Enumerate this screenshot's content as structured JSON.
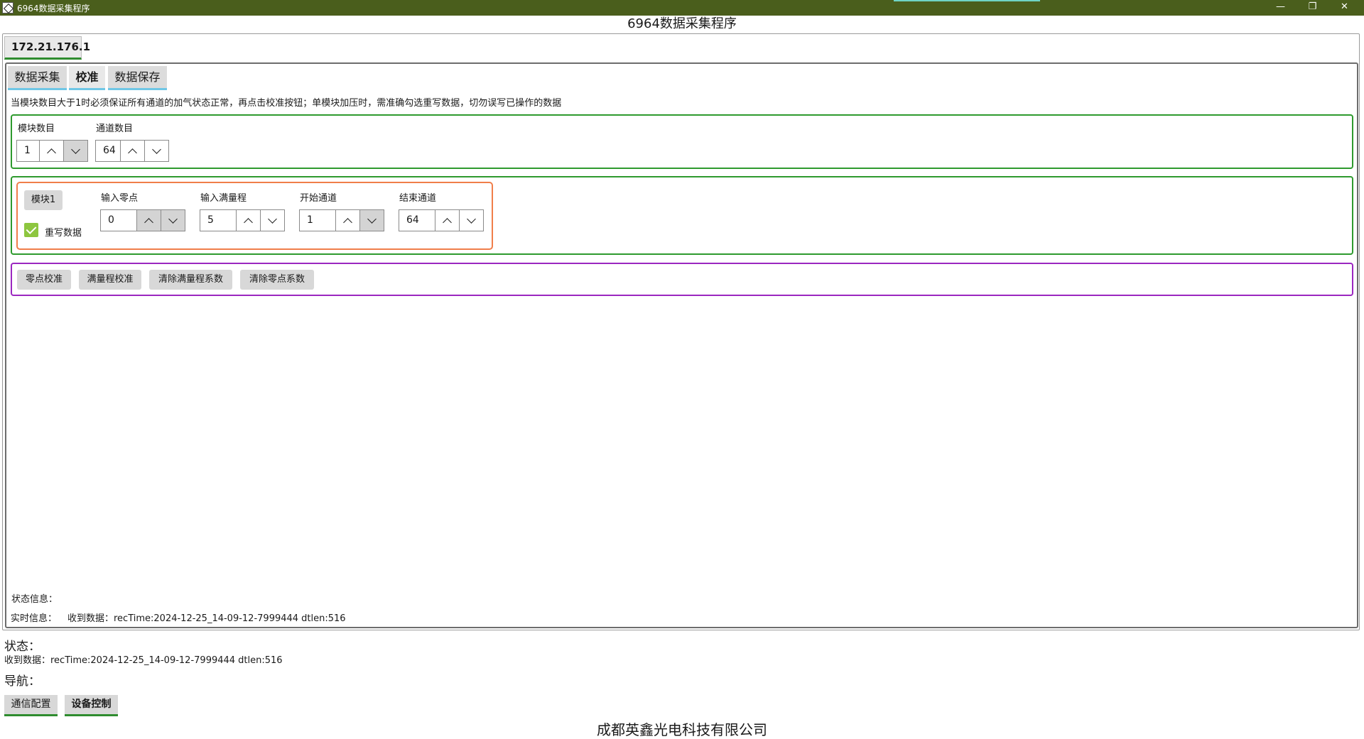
{
  "window": {
    "title": "6964数据采集程序",
    "minimize": "—",
    "restore": "❐",
    "close": "✕"
  },
  "header": {
    "title": "6964数据采集程序"
  },
  "device_tab": {
    "label": "172.21.176.1"
  },
  "tabs": [
    {
      "label": "数据采集"
    },
    {
      "label": "校准"
    },
    {
      "label": "数据保存"
    }
  ],
  "calibration": {
    "instruction": "当模块数目大于1时必须保证所有通道的加气状态正常，再点击校准按钮；单模块加压时，需准确勾选重写数据，切勿误写已操作的数据",
    "module_count": {
      "label": "模块数目",
      "value": "1"
    },
    "channel_count": {
      "label": "通道数目",
      "value": "64"
    },
    "module1": {
      "button": "模块1",
      "rewrite_label": "重写数据",
      "rewrite_checked": true,
      "zero_input": {
        "label": "输入零点",
        "value": "0"
      },
      "full_scale": {
        "label": "输入满量程",
        "value": "5"
      },
      "start_channel": {
        "label": "开始通道",
        "value": "1"
      },
      "end_channel": {
        "label": "结束通道",
        "value": "64"
      }
    },
    "actions": {
      "zero_cal": "零点校准",
      "full_cal": "满量程校准",
      "clear_full": "清除满量程系数",
      "clear_zero": "清除零点系数"
    },
    "status_info_label": "状态信息：",
    "realtime_info_label": "实时信息：",
    "realtime_info_value": "收到数据：recTime:2024-12-25_14-09-12-7999444 dtlen:516"
  },
  "status": {
    "label": "状态：",
    "message": "收到数据：recTime:2024-12-25_14-09-12-7999444 dtlen:516"
  },
  "nav": {
    "label": "导航：",
    "comm_config": "通信配置",
    "device_control": "设备控制"
  },
  "footer": {
    "company": "成都英鑫光电科技有限公司"
  },
  "colors": {
    "titlebar": "#4a5e1c",
    "green_border": "#2e9a2e",
    "purple_border": "#9b27c0",
    "orange_border": "#f07e4a",
    "checkbox": "#8dc63f"
  }
}
